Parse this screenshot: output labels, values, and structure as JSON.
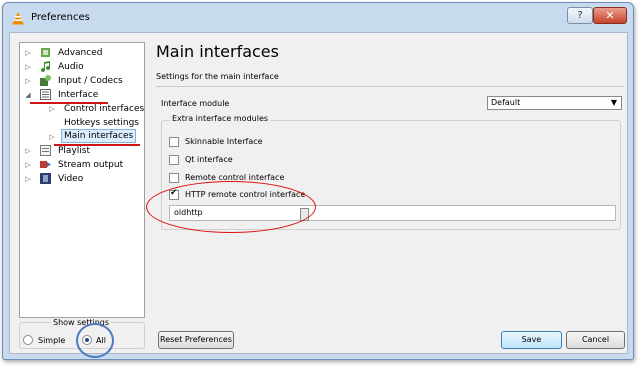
{
  "window": {
    "title": "Preferences",
    "help_label": "?",
    "close_label": "✕"
  },
  "sidebar": {
    "items": [
      {
        "label": "Advanced"
      },
      {
        "label": "Audio"
      },
      {
        "label": "Input / Codecs"
      },
      {
        "label": "Interface"
      },
      {
        "label": "Control interfaces"
      },
      {
        "label": "Hotkeys settings"
      },
      {
        "label": "Main interfaces"
      },
      {
        "label": "Playlist"
      },
      {
        "label": "Stream output"
      },
      {
        "label": "Video"
      }
    ]
  },
  "panel": {
    "title": "Main interfaces",
    "subtitle": "Settings for the main interface",
    "interface_module_label": "Interface module",
    "interface_module_value": "Default",
    "extra_modules_title": "Extra interface modules",
    "modules": [
      {
        "label": "Skinnable Interface",
        "checked": false
      },
      {
        "label": "Qt interface",
        "checked": false
      },
      {
        "label": "Remote control interface",
        "checked": false
      },
      {
        "label": "HTTP remote control interface",
        "checked": true
      }
    ],
    "module_text_value": "oldhttp"
  },
  "show_settings": {
    "title": "Show settings",
    "simple_label": "Simple",
    "all_label": "All",
    "selected": "All"
  },
  "buttons": {
    "reset_label": "Reset Preferences",
    "save_label": "Save",
    "cancel_label": "Cancel"
  },
  "annotation_colors": {
    "red": "#e01010",
    "blue": "#4d79c2"
  }
}
